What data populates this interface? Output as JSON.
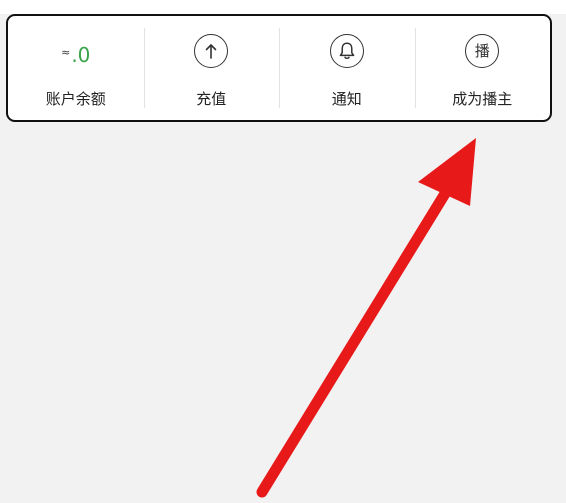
{
  "toolbar": {
    "balance": {
      "prefix": "≈",
      "amount": ".0",
      "label": "账户余额"
    },
    "recharge": {
      "icon": "arrow-up-icon",
      "label": "充值"
    },
    "notice": {
      "icon": "bell-icon",
      "label": "通知"
    },
    "become_host": {
      "icon_char": "播",
      "label": "成为播主"
    }
  },
  "annotation": {
    "arrow_color": "#e81919"
  },
  "colors": {
    "balance_green": "#3aa34a",
    "border": "#111111",
    "background": "#f2f2f2"
  }
}
